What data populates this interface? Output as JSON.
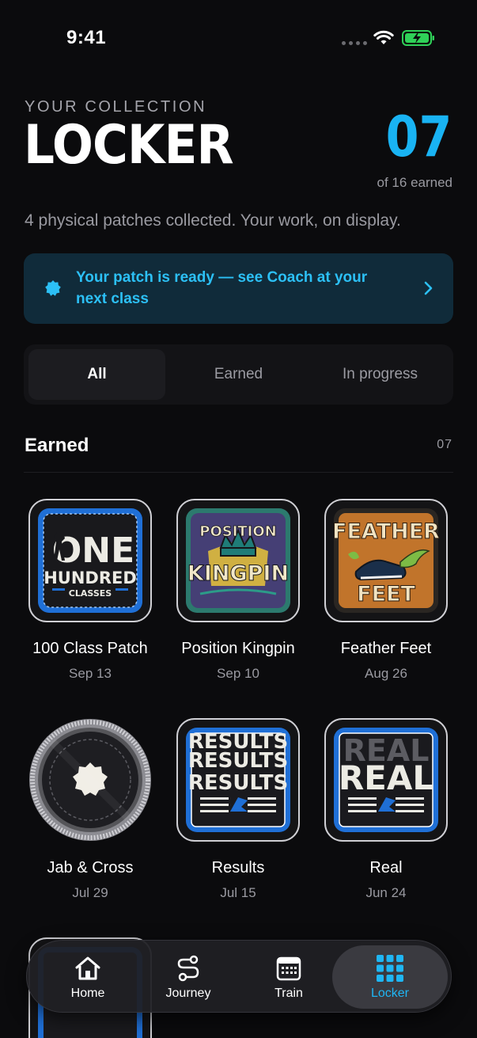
{
  "status": {
    "time": "9:41"
  },
  "header": {
    "eyebrow": "YOUR COLLECTION",
    "title": "LOCKER",
    "count": "07",
    "count_sub": "of 16 earned",
    "description": "4 physical patches collected. Your work, on display."
  },
  "alert": {
    "message": "Your patch is ready — see Coach at your next class",
    "icon": "badge-icon",
    "accent": "#19b3f3"
  },
  "tabs": [
    {
      "label": "All",
      "active": true
    },
    {
      "label": "Earned",
      "active": false
    },
    {
      "label": "In progress",
      "active": false
    }
  ],
  "section": {
    "title": "Earned",
    "count": "07"
  },
  "patches": [
    {
      "name": "100 Class Patch",
      "date": "Sep 13",
      "art": [
        "ONE",
        "HUNDRED",
        "CLASSES"
      ]
    },
    {
      "name": "Position Kingpin",
      "date": "Sep 10",
      "art": [
        "POSITION",
        "KINGPIN"
      ]
    },
    {
      "name": "Feather Feet",
      "date": "Aug 26",
      "art": [
        "FEATHER",
        "FEET"
      ]
    },
    {
      "name": "Jab & Cross",
      "date": "Jul 29"
    },
    {
      "name": "Results",
      "date": "Jul 15",
      "art": [
        "RESULTS",
        "RESULTS",
        "RESULTS"
      ]
    },
    {
      "name": "Real",
      "date": "Jun 24",
      "art": [
        "REAL",
        "REAL"
      ]
    }
  ],
  "nav": [
    {
      "label": "Home",
      "icon": "home-icon",
      "active": false
    },
    {
      "label": "Journey",
      "icon": "route-icon",
      "active": false
    },
    {
      "label": "Train",
      "icon": "calendar-icon",
      "active": false
    },
    {
      "label": "Locker",
      "icon": "grid-icon",
      "active": true
    }
  ],
  "colors": {
    "accent": "#19b3f3",
    "background": "#0b0b0d"
  }
}
